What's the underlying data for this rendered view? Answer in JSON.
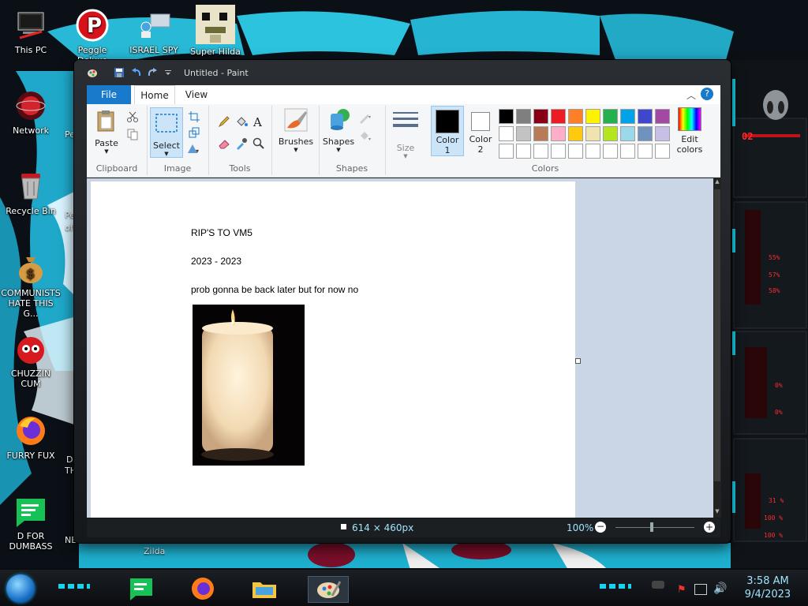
{
  "desktop": {
    "icons": [
      {
        "label": "This PC"
      },
      {
        "label": "Peggle Deluxe"
      },
      {
        "label": "ISRAEL SPY"
      },
      {
        "label": "Super Hilda"
      },
      {
        "label": "Network"
      },
      {
        "label": "Recycle Bin"
      },
      {
        "label": "COMMUNISTS HATE THIS G..."
      },
      {
        "label": "CHUZZIN CUM"
      },
      {
        "label": "FURRY FUX"
      },
      {
        "label": "D FOR DUMBASS"
      }
    ],
    "partial_labels": [
      "Pe",
      "Pe",
      "of",
      "D",
      "TH",
      "NE",
      "Zilda"
    ]
  },
  "window": {
    "title": "Untitled - Paint",
    "tabs": [
      "File",
      "Home",
      "View"
    ]
  },
  "ribbon": {
    "clipboard": {
      "paste": "Paste",
      "label": "Clipboard"
    },
    "image": {
      "select": "Select",
      "label": "Image"
    },
    "tools": {
      "label": "Tools"
    },
    "brushes": {
      "label": "Brushes"
    },
    "shapes": {
      "shapes": "Shapes",
      "label": "Shapes"
    },
    "size": {
      "label": "Size"
    },
    "color1": {
      "line1": "Color",
      "line2": "1"
    },
    "color2": {
      "line1": "Color",
      "line2": "2"
    },
    "colors": {
      "label": "Colors",
      "edit_line1": "Edit",
      "edit_line2": "colors",
      "row1": [
        "#000000",
        "#7f7f7f",
        "#880015",
        "#ed1c24",
        "#ff7f27",
        "#fff200",
        "#22b14c",
        "#00a2e8",
        "#3f48cc",
        "#a349a4"
      ],
      "row2": [
        "#ffffff",
        "#c3c3c3",
        "#b97a57",
        "#ffaec9",
        "#ffc90e",
        "#efe4b0",
        "#b5e61d",
        "#99d9ea",
        "#7092be",
        "#c8bfe7"
      ]
    }
  },
  "canvas": {
    "lines": [
      "RIP'S TO VM5",
      "2023 - 2023",
      "prob gonna be back later but for now no"
    ]
  },
  "status": {
    "dimensions": "614 × 460px",
    "zoom": "100%"
  },
  "gadget": {
    "readouts": [
      "02",
      "55%",
      "57%",
      "58%",
      "0%",
      "0%",
      "31 %",
      "100 %",
      "100 %"
    ]
  },
  "taskbar": {
    "time": "3:58 AM",
    "date": "9/4/2023"
  }
}
